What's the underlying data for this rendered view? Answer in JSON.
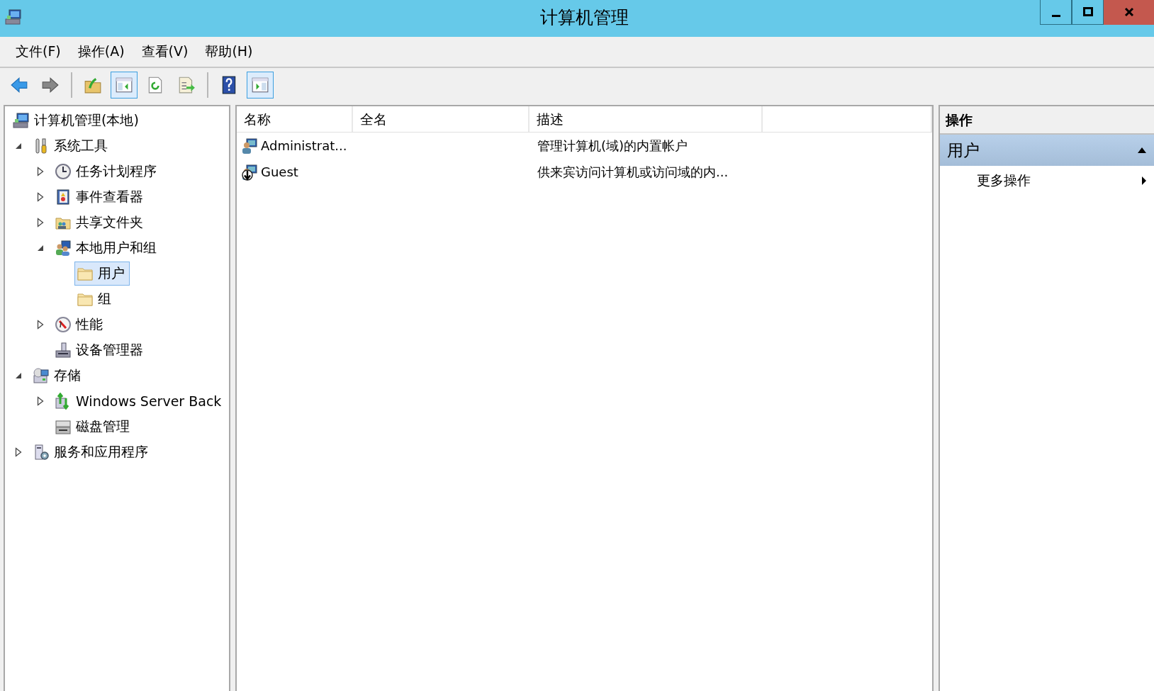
{
  "window": {
    "title": "计算机管理"
  },
  "menu": [
    "文件(F)",
    "操作(A)",
    "查看(V)",
    "帮助(H)"
  ],
  "toolbar": [
    {
      "kind": "back",
      "on": false
    },
    {
      "kind": "forward",
      "on": false
    },
    {
      "kind": "separator"
    },
    {
      "kind": "up",
      "on": false
    },
    {
      "kind": "tree-toggle",
      "on": true
    },
    {
      "kind": "refresh",
      "on": false
    },
    {
      "kind": "export",
      "on": false
    },
    {
      "kind": "separator"
    },
    {
      "kind": "help",
      "on": false
    },
    {
      "kind": "pane-toggle",
      "on": true
    }
  ],
  "tree": [
    {
      "label": "计算机管理(本地)",
      "kind": "computer",
      "selected": false,
      "children": [
        {
          "label": "系统工具",
          "kind": "tools",
          "expanded": true,
          "selected": false,
          "children": [
            {
              "label": "任务计划程序",
              "kind": "clock",
              "expanded": false,
              "selected": false
            },
            {
              "label": "事件查看器",
              "kind": "log",
              "expanded": false,
              "selected": false
            },
            {
              "label": "共享文件夹",
              "kind": "share",
              "expanded": false,
              "selected": false
            },
            {
              "label": "本地用户和组",
              "kind": "users",
              "expanded": true,
              "selected": false,
              "children": [
                {
                  "label": "用户",
                  "kind": "folder",
                  "selected": true
                },
                {
                  "label": "组",
                  "kind": "folder",
                  "selected": false
                }
              ]
            },
            {
              "label": "性能",
              "kind": "perf",
              "expanded": false,
              "selected": false
            },
            {
              "label": "设备管理器",
              "kind": "device",
              "selected": false
            }
          ]
        },
        {
          "label": "存储",
          "kind": "storage",
          "expanded": true,
          "selected": false,
          "children": [
            {
              "label": "Windows Server Back",
              "kind": "backup",
              "expanded": false,
              "selected": false
            },
            {
              "label": "磁盘管理",
              "kind": "disk",
              "selected": false
            }
          ]
        },
        {
          "label": "服务和应用程序",
          "kind": "services",
          "expanded": false,
          "selected": false
        }
      ]
    }
  ],
  "list": {
    "columns": [
      "名称",
      "全名",
      "描述"
    ],
    "rows": [
      {
        "name": "Administrat...",
        "description": "管理计算机(域)的内置帐户",
        "disabled": false
      },
      {
        "name": "Guest",
        "description": "供来宾访问计算机或访问域的内...",
        "disabled": true
      }
    ]
  },
  "actions": {
    "title": "操作",
    "sections": [
      {
        "label": "用户",
        "expanded": true,
        "items": [
          "更多操作"
        ]
      }
    ]
  }
}
